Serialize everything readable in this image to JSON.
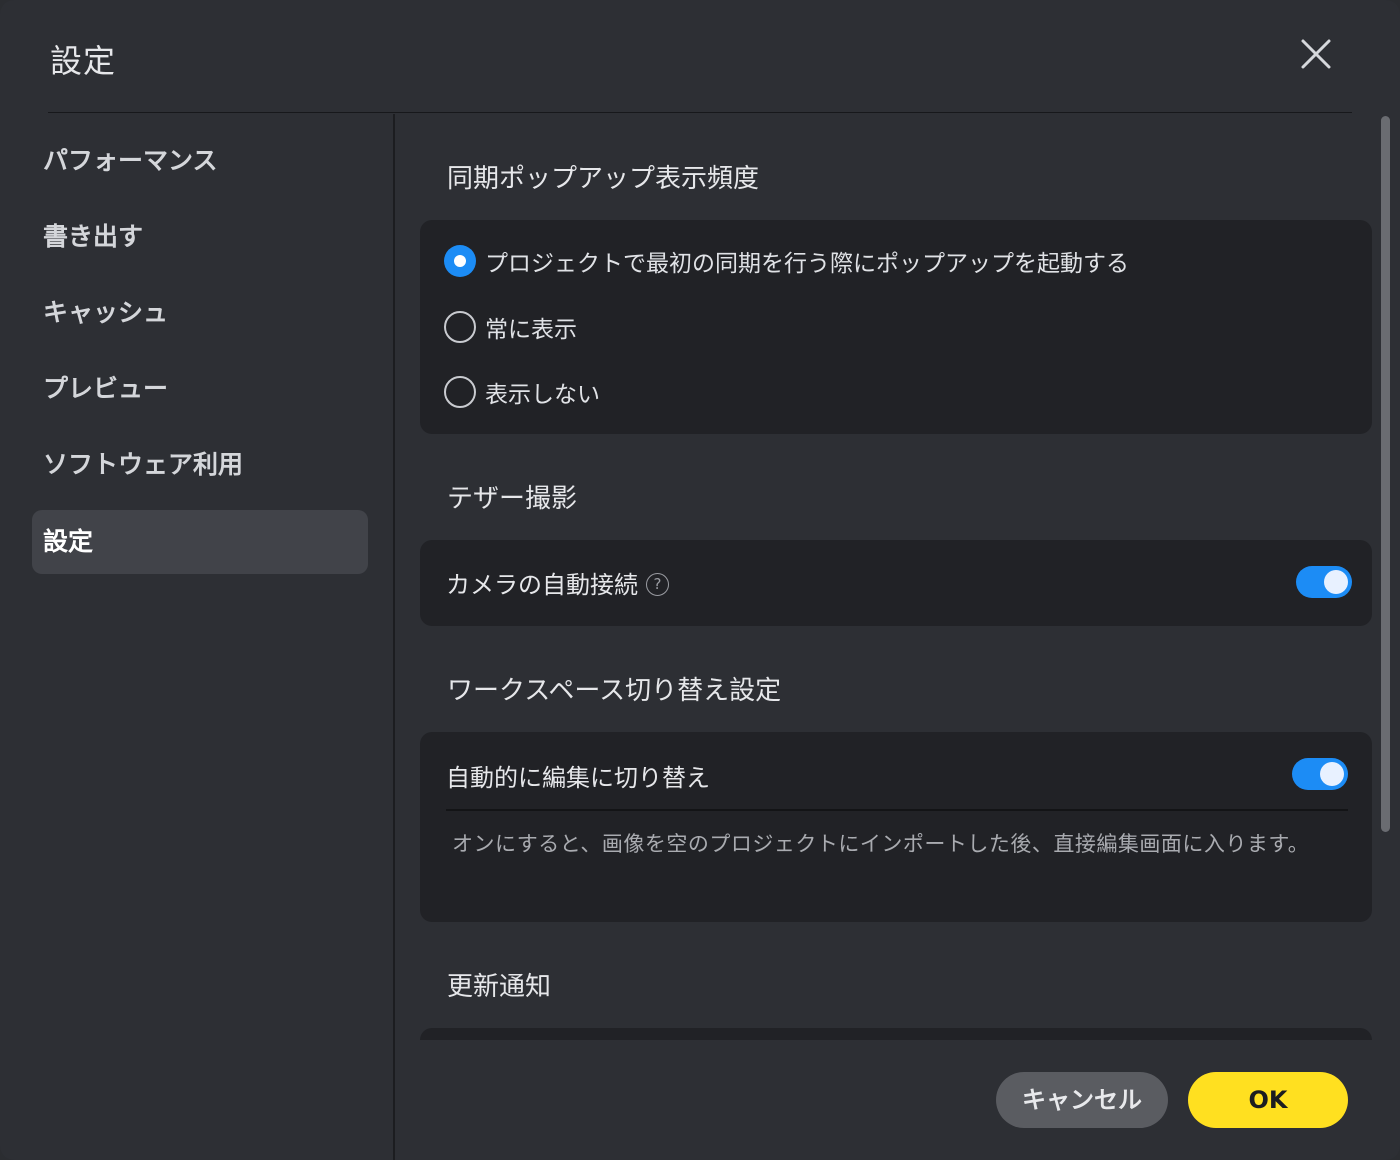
{
  "dialog": {
    "title": "設定",
    "close_icon": "close-icon"
  },
  "sidebar": {
    "items": [
      {
        "label": "パフォーマンス",
        "active": false
      },
      {
        "label": "書き出す",
        "active": false
      },
      {
        "label": "キャッシュ",
        "active": false
      },
      {
        "label": "プレビュー",
        "active": false
      },
      {
        "label": "ソフトウェア利用",
        "active": false
      },
      {
        "label": "設定",
        "active": true
      }
    ]
  },
  "sync_popup": {
    "title": "同期ポップアップ表示頻度",
    "options": [
      {
        "label": "プロジェクトで最初の同期を行う際にポップアップを起動する",
        "selected": true
      },
      {
        "label": "常に表示",
        "selected": false
      },
      {
        "label": "表示しない",
        "selected": false
      }
    ]
  },
  "tether": {
    "title": "テザー撮影",
    "auto_connect_label": "カメラの自動接続",
    "auto_connect_on": true,
    "help_glyph": "?"
  },
  "workspace": {
    "title": "ワークスペース切り替え設定",
    "auto_edit_label": "自動的に編集に切り替え",
    "auto_edit_on": true,
    "description": "オンにすると、画像を空のプロジェクトにインポートした後、直接編集画面に入ります。"
  },
  "update_notice": {
    "title": "更新通知"
  },
  "footer": {
    "cancel_label": "キャンセル",
    "ok_label": "OK"
  },
  "colors": {
    "accent": "#1c8cf5",
    "ok_button": "#ffe020",
    "background": "#2d2f34",
    "card": "#212226"
  }
}
